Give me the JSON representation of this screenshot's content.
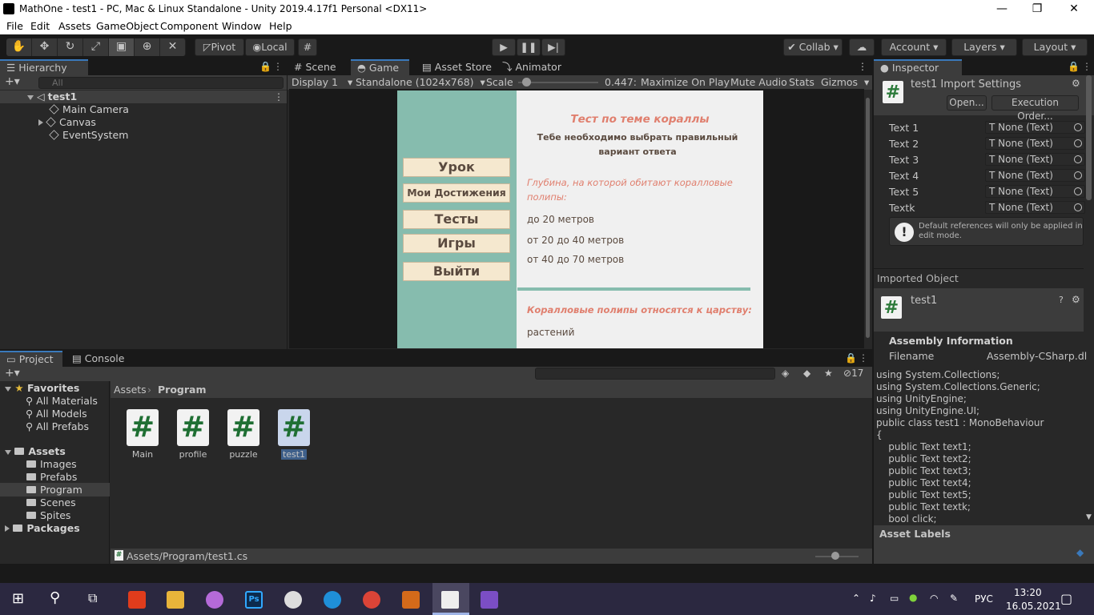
{
  "window": {
    "title": "MathOne - test1 - PC, Mac & Linux Standalone - Unity 2019.4.17f1 Personal <DX11>",
    "controls": {
      "minimize": "—",
      "restore": "❐",
      "close": "✕"
    }
  },
  "menu": [
    "File",
    "Edit",
    "Assets",
    "GameObject",
    "Component",
    "Window",
    "Help"
  ],
  "toolbar": {
    "tools": [
      "hand-tool-icon",
      "move-tool-icon",
      "rotate-tool-icon",
      "scale-tool-icon",
      "rect-tool-icon",
      "transform-tool-icon",
      "custom-tool-icon"
    ],
    "pivot": "Pivot",
    "local": "Local",
    "collab": "Collab",
    "account": "Account",
    "layers": "Layers",
    "layout": "Layout"
  },
  "hierarchy": {
    "tab": "Hierarchy",
    "search_placeholder": "All",
    "scene": "test1",
    "items": [
      "Main Camera",
      "Canvas",
      "EventSystem"
    ]
  },
  "game": {
    "tabs": [
      "Scene",
      "Game",
      "Asset Store",
      "Animator"
    ],
    "display": "Display 1",
    "resolution": "Standalone (1024x768)",
    "scale_label": "Scale",
    "scale_value": "0.447",
    "scale_fraction": 0.1,
    "buttons": [
      "Maximize On Play",
      "Mute Audio",
      "Stats",
      "Gizmos"
    ],
    "canvas": {
      "menu": [
        "Урок",
        "Мои Достижения",
        "Тесты",
        "Игры",
        "Выйти"
      ],
      "title": "Тест по теме кораллы",
      "subtitle1": "Тебе необходимо выбрать правильный",
      "subtitle2": "вариант ответа",
      "q1_line1": "Глубина, на которой обитают коралловые",
      "q1_line2": "полипы:",
      "q1_answers": [
        "до 20 метров",
        "от 20  до 40 метров",
        "от 40  до 70 метров"
      ],
      "q2": "Коралловые полипы относятся к царству:",
      "q2_answers": [
        "растений"
      ]
    }
  },
  "inspector": {
    "tab": "Inspector",
    "title": "test1 Import Settings",
    "open_btn": "Open...",
    "exec_btn": "Execution Order...",
    "fields": [
      {
        "label": "Text 1",
        "value": "None (Text)"
      },
      {
        "label": "Text 2",
        "value": "None (Text)"
      },
      {
        "label": "Text 3",
        "value": "None (Text)"
      },
      {
        "label": "Text 4",
        "value": "None (Text)"
      },
      {
        "label": "Text 5",
        "value": "None (Text)"
      },
      {
        "label": "Textk",
        "value": "None (Text)"
      }
    ],
    "warning": "Default references will only be applied in edit mode.",
    "imported_object": "Imported Object",
    "object_name": "test1",
    "assembly_header": "Assembly Information",
    "filename_label": "Filename",
    "filename_value": "Assembly-CSharp.dl",
    "code_lines": [
      "using System.Collections;",
      "using System.Collections.Generic;",
      "using UnityEngine;",
      "using UnityEngine.UI;",
      "public class test1 : MonoBehaviour",
      "{",
      "    public Text text1;",
      "    public Text text2;",
      "    public Text text3;",
      "    public Text text4;",
      "    public Text text5;",
      "    public Text textk;",
      "    bool click;"
    ],
    "asset_labels": "Asset Labels"
  },
  "project": {
    "tabs": [
      "Project",
      "Console"
    ],
    "hidden_count": "17",
    "favorites": "Favorites",
    "fav_items": [
      "All Materials",
      "All Models",
      "All Prefabs"
    ],
    "assets": "Assets",
    "asset_folders": [
      "Images",
      "Prefabs",
      "Program",
      "Scenes",
      "Spites"
    ],
    "packages": "Packages",
    "breadcrumb": [
      "Assets",
      "Program"
    ],
    "files": [
      "Main",
      "profile",
      "puzzle",
      "test1"
    ],
    "path": "Assets/Program/test1.cs"
  },
  "taskbar": {
    "lang": "РУС",
    "time": "13:20",
    "date": "16.05.2021"
  },
  "colors": {
    "accent": "#3a79bb",
    "teal": "#86bcae",
    "button_bg": "#f5e8cf",
    "question": "#e07f6e"
  }
}
